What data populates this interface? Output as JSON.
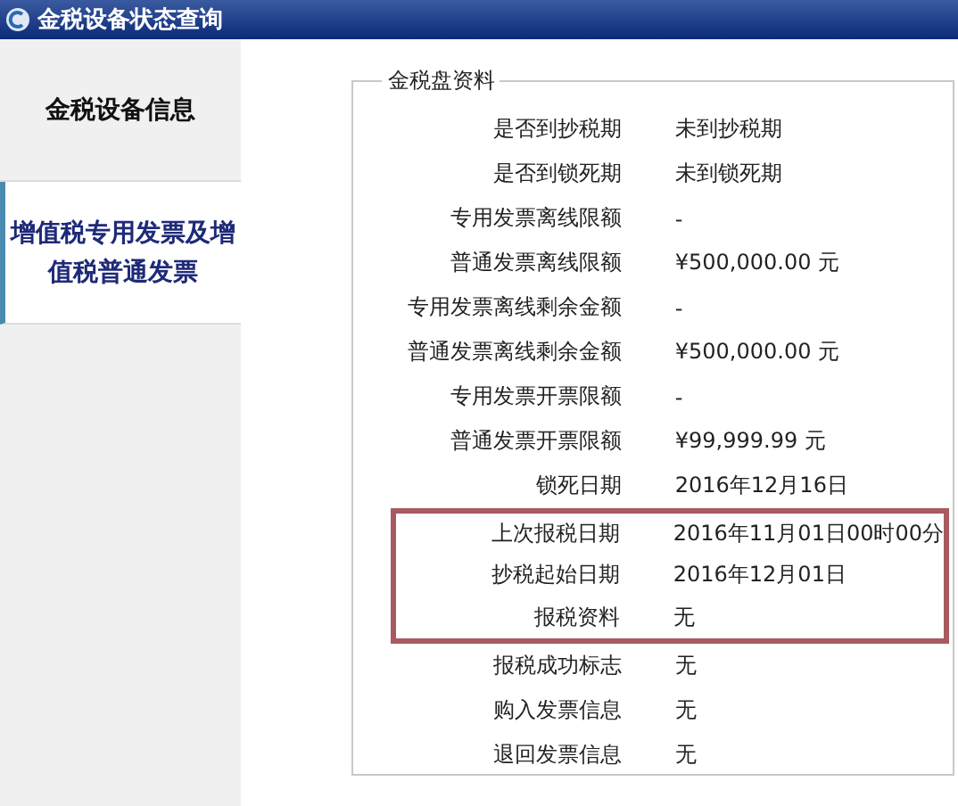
{
  "window": {
    "title": "金税设备状态查询"
  },
  "tabs": [
    {
      "label": "金税设备信息",
      "selected": false
    },
    {
      "label": "增值税专用发票及增值税普通发票",
      "selected": true
    }
  ],
  "panel": {
    "legend": "金税盘资料",
    "groups": [
      {
        "highlighted": false,
        "rows": [
          {
            "label": "是否到抄税期",
            "value": "未到抄税期"
          },
          {
            "label": "是否到锁死期",
            "value": "未到锁死期"
          },
          {
            "label": "专用发票离线限额",
            "value": "-"
          },
          {
            "label": "普通发票离线限额",
            "value": "¥500,000.00 元"
          },
          {
            "label": "专用发票离线剩余金额",
            "value": "-"
          },
          {
            "label": "普通发票离线剩余金额",
            "value": "¥500,000.00 元"
          },
          {
            "label": "专用发票开票限额",
            "value": "-"
          },
          {
            "label": "普通发票开票限额",
            "value": "¥99,999.99 元"
          },
          {
            "label": "锁死日期",
            "value": "2016年12月16日"
          }
        ]
      },
      {
        "highlighted": true,
        "rows": [
          {
            "label": "上次报税日期",
            "value": "2016年11月01日00时00分"
          },
          {
            "label": "抄税起始日期",
            "value": "2016年12月01日"
          },
          {
            "label": "报税资料",
            "value": "无"
          }
        ]
      },
      {
        "highlighted": false,
        "rows": [
          {
            "label": "报税成功标志",
            "value": "无"
          },
          {
            "label": "购入发票信息",
            "value": "无"
          },
          {
            "label": "退回发票信息",
            "value": "无"
          }
        ]
      }
    ]
  }
}
